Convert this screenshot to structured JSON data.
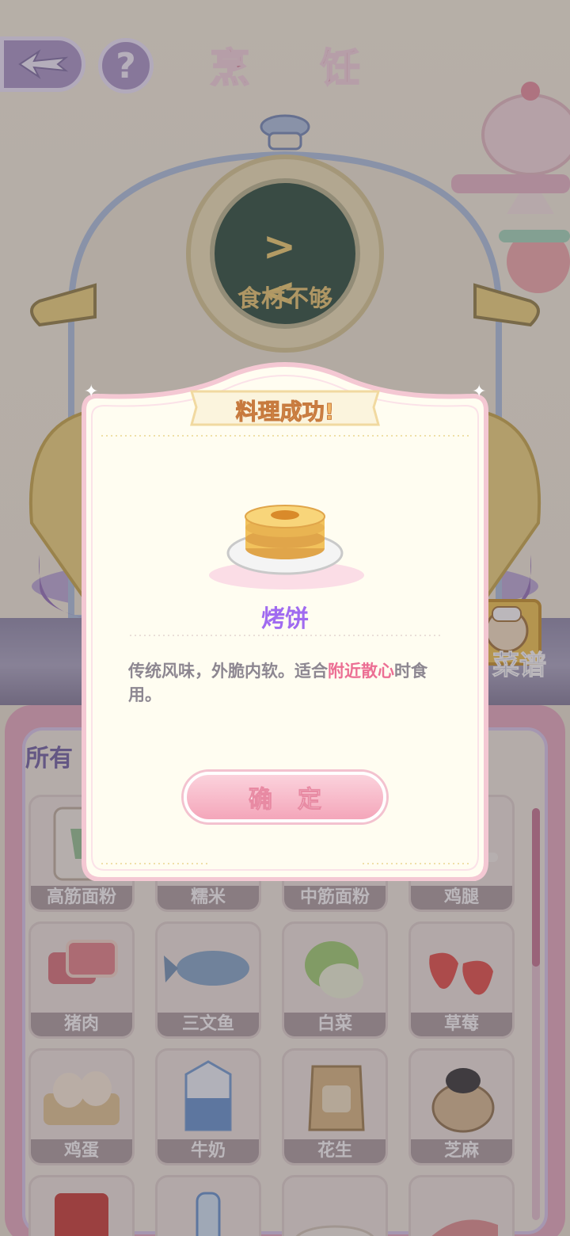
{
  "header": {
    "title": "烹 饪",
    "back_icon": "back-arrow-icon",
    "help_label": "?"
  },
  "robot": {
    "screen_text": "食材不够",
    "face": "> <"
  },
  "recipe_button": {
    "label": "菜谱"
  },
  "inventory": {
    "tab_label": "所有",
    "items": [
      {
        "name": "高筋面粉"
      },
      {
        "name": "糯米"
      },
      {
        "name": "中筋面粉"
      },
      {
        "name": "鸡腿"
      },
      {
        "name": "猪肉"
      },
      {
        "name": "三文鱼"
      },
      {
        "name": "白菜"
      },
      {
        "name": "草莓"
      },
      {
        "name": "鸡蛋"
      },
      {
        "name": "牛奶"
      },
      {
        "name": "花生"
      },
      {
        "name": "芝麻"
      },
      {
        "name": ""
      },
      {
        "name": ""
      },
      {
        "name": ""
      },
      {
        "name": ""
      }
    ]
  },
  "dialog": {
    "title": "料理成功!",
    "food_name": "烤饼",
    "desc_before": "传统风味，外脆内软。适合",
    "desc_highlight": "附近散心",
    "desc_after": "时食用。",
    "confirm_label": "确定",
    "food_icon": "pancake-plate-icon"
  },
  "colors": {
    "title_pink": "#d36a86",
    "lavender": "#a592c6",
    "highlight": "#ec6f94",
    "food_name": "#a06bf0",
    "confirm_pink": "#f4a6ba"
  }
}
